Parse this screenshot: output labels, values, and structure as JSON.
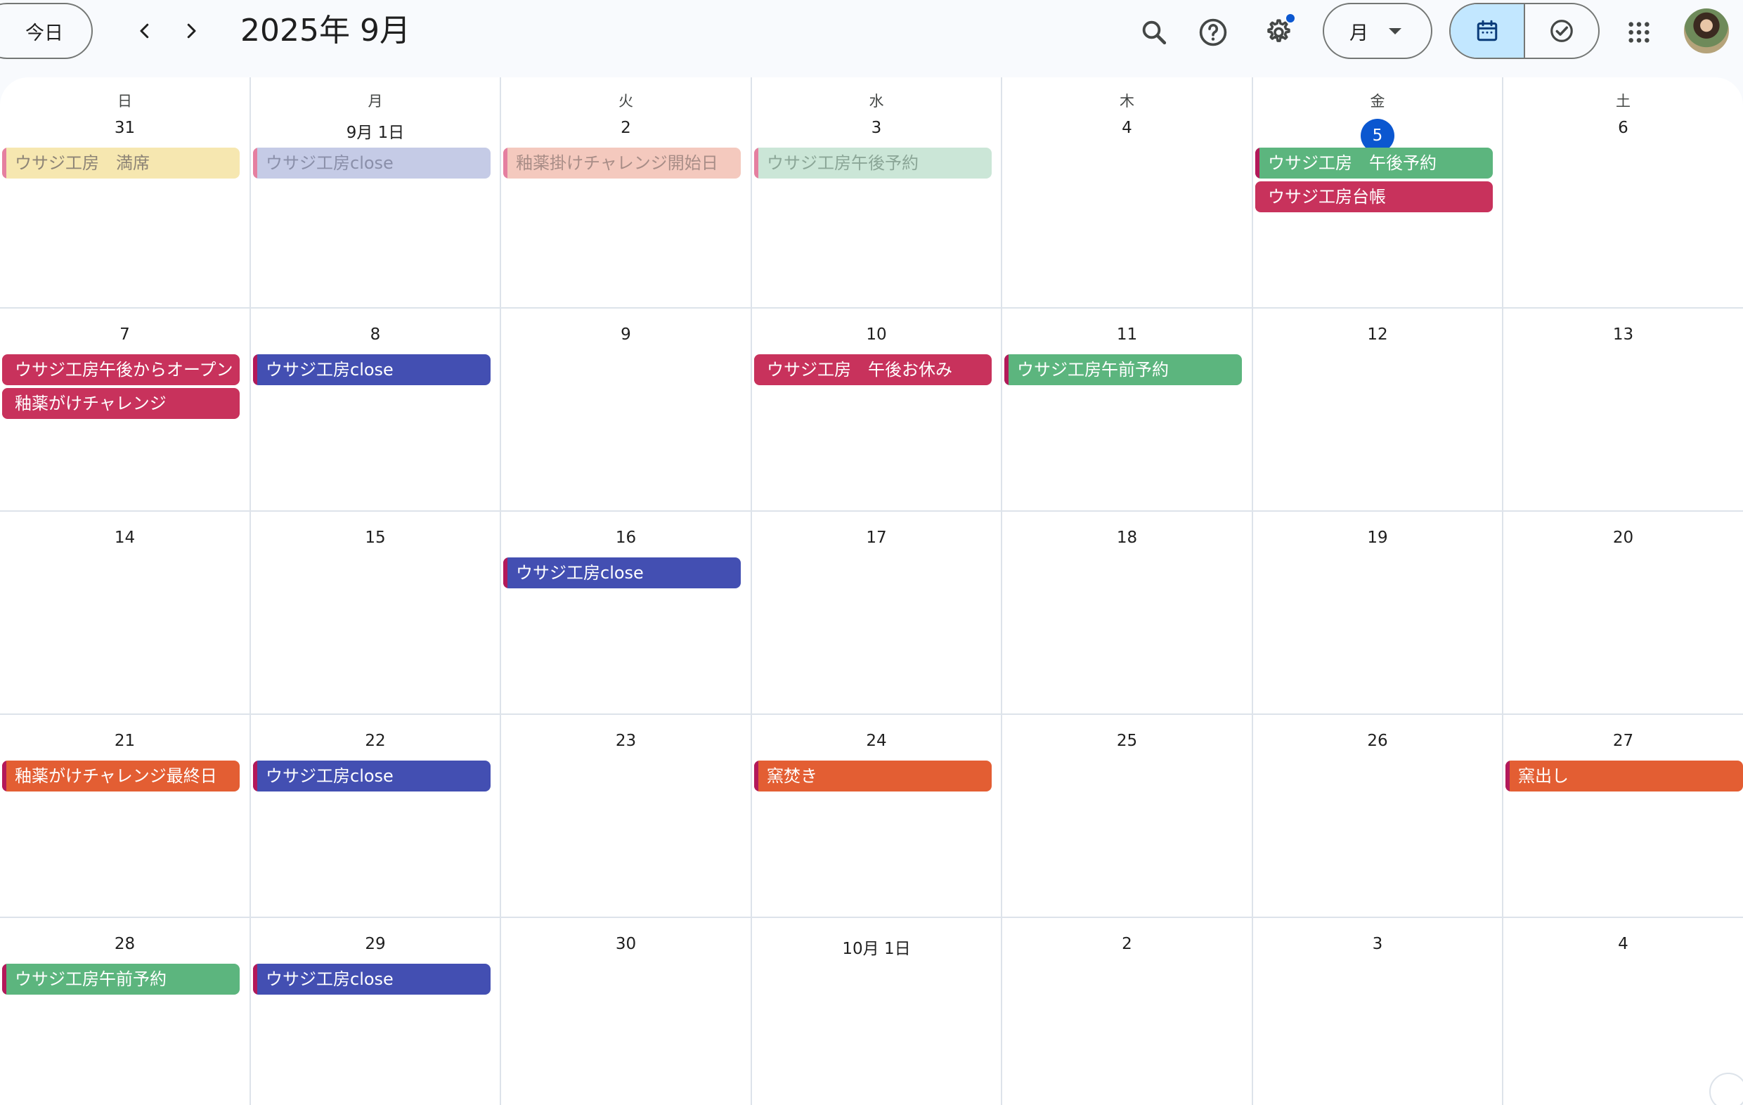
{
  "header": {
    "today_label": "今日",
    "title": "2025年 9月",
    "view_label": "月"
  },
  "icons": {
    "search": "search-icon",
    "help": "help-icon",
    "settings": "gear-icon",
    "calendar_view": "calendar-icon",
    "tasks_view": "tasks-check-icon",
    "apps": "apps-grid-icon"
  },
  "calendar": {
    "weekdays": [
      "日",
      "月",
      "火",
      "水",
      "木",
      "金",
      "土"
    ],
    "weeks": [
      {
        "dates": [
          "31",
          "9月 1日",
          "2",
          "3",
          "4",
          "5",
          "6"
        ],
        "events": [
          [
            "ウサジ工房　満席"
          ],
          [
            "ウサジ工房close"
          ],
          [
            "釉薬掛けチャレンジ開始日"
          ],
          [
            "ウサジ工房午後予約"
          ],
          [],
          [
            "ウサジ工房　午後予約",
            "ウサジ工房台帳"
          ],
          []
        ]
      },
      {
        "dates": [
          "7",
          "8",
          "9",
          "10",
          "11",
          "12",
          "13"
        ],
        "events": [
          [
            "ウサジ工房午後からオープン",
            "釉薬がけチャレンジ"
          ],
          [
            "ウサジ工房close"
          ],
          [],
          [
            "ウサジ工房　午後お休み"
          ],
          [
            "ウサジ工房午前予約"
          ],
          [],
          []
        ]
      },
      {
        "dates": [
          "14",
          "15",
          "16",
          "17",
          "18",
          "19",
          "20"
        ],
        "events": [
          [],
          [],
          [
            "ウサジ工房close"
          ],
          [],
          [],
          [],
          []
        ]
      },
      {
        "dates": [
          "21",
          "22",
          "23",
          "24",
          "25",
          "26",
          "27"
        ],
        "events": [
          [
            "釉薬がけチャレンジ最終日"
          ],
          [
            "ウサジ工房close"
          ],
          [],
          [
            "窯焚き"
          ],
          [],
          [],
          [
            "窯出し"
          ]
        ]
      },
      {
        "dates": [
          "28",
          "29",
          "30",
          "10月 1日",
          "2",
          "3",
          "4"
        ],
        "events": [
          [
            "ウサジ工房午前予約"
          ],
          [
            "ウサジ工房close"
          ],
          [],
          [],
          [],
          [],
          []
        ]
      }
    ]
  },
  "colors": {
    "today_circle": "#0b57d0",
    "past_yellow_bg": "#f6e7b0",
    "past_yellow_text": "#8d8476",
    "past_lavender_bg": "#c5cbe6",
    "past_lavender_text": "#8a8fa9",
    "past_peach_bg": "#f4c9be",
    "past_peach_text": "#a88d87",
    "past_mint_bg": "#cbe6d7",
    "past_mint_text": "#8ba697",
    "green": "#5cb57e",
    "crimson": "#c8325c",
    "blue": "#434fb2",
    "orange": "#e35e33",
    "accent_edge_pink": "#e57fa0",
    "accent_edge_crimson": "#b3195a"
  }
}
